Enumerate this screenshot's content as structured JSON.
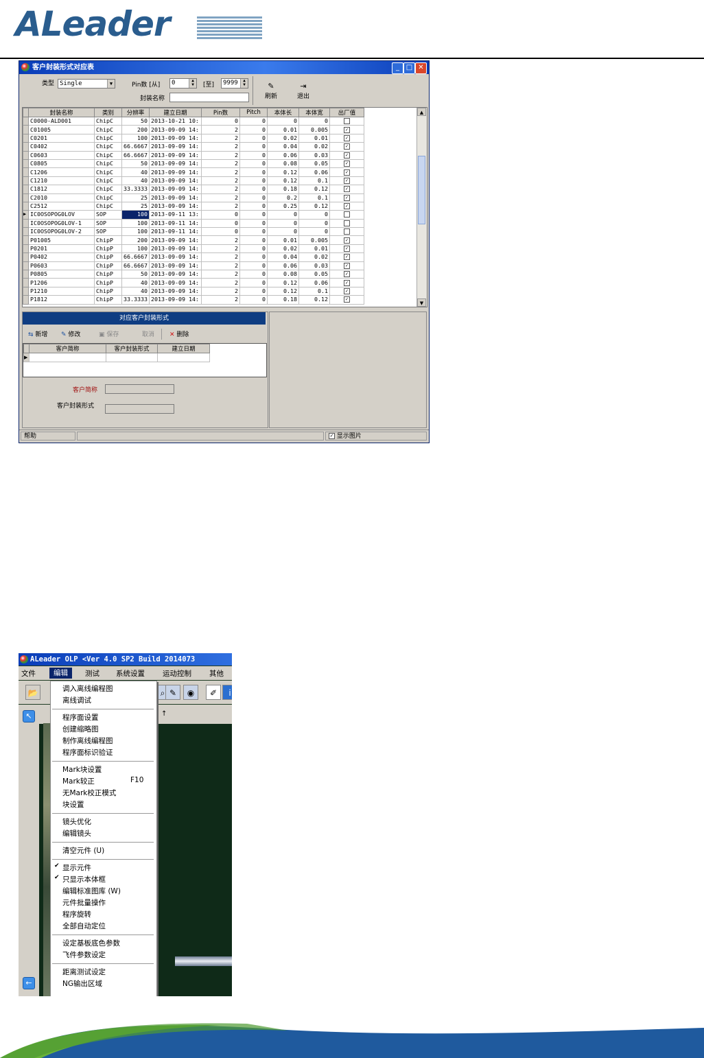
{
  "logo": {
    "text": "ALeader"
  },
  "window1": {
    "title": "客户封装形式对应表",
    "filter": {
      "type_label": "类型",
      "type_value": "Single",
      "pin_label": "Pin数 [从]",
      "pin_from": "0",
      "pin_to_label": "[至]",
      "pin_to": "9999",
      "package_name_label": "封装名称",
      "package_name_value": ""
    },
    "buttons": {
      "refresh": "刷新",
      "exit": "退出"
    },
    "columns": [
      "封装名称",
      "类别",
      "分辨率",
      "建立日期",
      "Pin数",
      "Pitch",
      "本体长",
      "本体宽",
      "出厂值"
    ],
    "rows": [
      [
        "C0000-ALD001",
        "ChipC",
        "50",
        "2013-10-21 10:",
        "0",
        "0",
        "0",
        "0",
        false
      ],
      [
        "C01005",
        "ChipC",
        "200",
        "2013-09-09 14:",
        "2",
        "0",
        "0.01",
        "0.005",
        true
      ],
      [
        "C0201",
        "ChipC",
        "100",
        "2013-09-09 14:",
        "2",
        "0",
        "0.02",
        "0.01",
        true
      ],
      [
        "C0402",
        "ChipC",
        "66.6667",
        "2013-09-09 14:",
        "2",
        "0",
        "0.04",
        "0.02",
        true
      ],
      [
        "C0603",
        "ChipC",
        "66.6667",
        "2013-09-09 14:",
        "2",
        "0",
        "0.06",
        "0.03",
        true
      ],
      [
        "C0805",
        "ChipC",
        "50",
        "2013-09-09 14:",
        "2",
        "0",
        "0.08",
        "0.05",
        true
      ],
      [
        "C1206",
        "ChipC",
        "40",
        "2013-09-09 14:",
        "2",
        "0",
        "0.12",
        "0.06",
        true
      ],
      [
        "C1210",
        "ChipC",
        "40",
        "2013-09-09 14:",
        "2",
        "0",
        "0.12",
        "0.1",
        true
      ],
      [
        "C1812",
        "ChipC",
        "33.3333",
        "2013-09-09 14:",
        "2",
        "0",
        "0.18",
        "0.12",
        true
      ],
      [
        "C2010",
        "ChipC",
        "25",
        "2013-09-09 14:",
        "2",
        "0",
        "0.2",
        "0.1",
        true
      ],
      [
        "C2512",
        "ChipC",
        "25",
        "2013-09-09 14:",
        "2",
        "0",
        "0.25",
        "0.12",
        true
      ],
      [
        "IC0OSOPOG0LOV",
        "SOP",
        "100",
        "2013-09-11 13:",
        "0",
        "0",
        "0",
        "0",
        false
      ],
      [
        "IC0OSOPOG0LOV-1",
        "SOP",
        "100",
        "2013-09-11 14:",
        "0",
        "0",
        "0",
        "0",
        false
      ],
      [
        "IC0OSOPOG0LOV-2",
        "SOP",
        "100",
        "2013-09-11 14:",
        "0",
        "0",
        "0",
        "0",
        false
      ],
      [
        "P01005",
        "ChipP",
        "200",
        "2013-09-09 14:",
        "2",
        "0",
        "0.01",
        "0.005",
        true
      ],
      [
        "P0201",
        "ChipP",
        "100",
        "2013-09-09 14:",
        "2",
        "0",
        "0.02",
        "0.01",
        true
      ],
      [
        "P0402",
        "ChipP",
        "66.6667",
        "2013-09-09 14:",
        "2",
        "0",
        "0.04",
        "0.02",
        true
      ],
      [
        "P0603",
        "ChipP",
        "66.6667",
        "2013-09-09 14:",
        "2",
        "0",
        "0.06",
        "0.03",
        true
      ],
      [
        "P0805",
        "ChipP",
        "50",
        "2013-09-09 14:",
        "2",
        "0",
        "0.08",
        "0.05",
        true
      ],
      [
        "P1206",
        "ChipP",
        "40",
        "2013-09-09 14:",
        "2",
        "0",
        "0.12",
        "0.06",
        true
      ],
      [
        "P1210",
        "ChipP",
        "40",
        "2013-09-09 14:",
        "2",
        "0",
        "0.12",
        "0.1",
        true
      ],
      [
        "P1812",
        "ChipP",
        "33.3333",
        "2013-09-09 14:",
        "2",
        "0",
        "0.18",
        "0.12",
        true
      ]
    ],
    "selected_row": 11,
    "sub_header": "对应客户封装形式",
    "sub_toolbar": {
      "add": "新增",
      "edit": "修改",
      "save": "保存",
      "cancel": "取消",
      "delete": "删除"
    },
    "sub_columns": [
      "客户简称",
      "客户封装形式",
      "建立日期"
    ],
    "customer_short_label": "客户简称",
    "customer_package_label": "客户封装形式",
    "status_help": "帮助",
    "show_image_label": "显示图片"
  },
  "window2": {
    "title": "ALeader OLP  <Ver 4.0 SP2 Build 2014073",
    "menu": [
      "文件",
      "编辑",
      "测试",
      "系统设置",
      "运动控制",
      "其他"
    ],
    "active_menu": "编辑",
    "toolbar_hint": "↑",
    "dropdown_groups": [
      [
        {
          "label": "调入离线编程图"
        },
        {
          "label": "离线调试"
        }
      ],
      [
        {
          "label": "程序面设置"
        },
        {
          "label": "创建缩略图"
        },
        {
          "label": "制作离线编程图"
        },
        {
          "label": "程序面标识验证"
        }
      ],
      [
        {
          "label": "Mark块设置"
        },
        {
          "label": "Mark较正",
          "key": "F10"
        },
        {
          "label": "无Mark校正模式"
        },
        {
          "label": "块设置"
        }
      ],
      [
        {
          "label": "镜头优化"
        },
        {
          "label": "编辑镜头"
        }
      ],
      [
        {
          "label": "清空元件 (U)"
        }
      ],
      [
        {
          "label": "显示元件",
          "checked": true
        },
        {
          "label": "只显示本体框",
          "checked": true
        },
        {
          "label": "编辑标准图库 (W)"
        },
        {
          "label": "元件批量操作"
        },
        {
          "label": "程序旋转"
        },
        {
          "label": "全部自动定位"
        }
      ],
      [
        {
          "label": "设定基板底色参数"
        },
        {
          "label": "飞件参数设定"
        }
      ],
      [
        {
          "label": "距离测试设定"
        },
        {
          "label": "NG输出区域"
        }
      ]
    ]
  },
  "colors": {
    "title_blue": "#0a3db8",
    "selection": "#0a246a",
    "brand_green": "#6ab33a",
    "brand_blue": "#1f5a9e"
  }
}
